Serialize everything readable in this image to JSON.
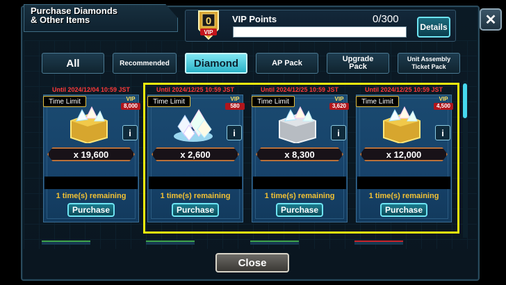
{
  "header": {
    "title_line1": "Purchase Diamonds",
    "title_line2": "& Other Items",
    "close_icon": "close-icon"
  },
  "vip": {
    "badge_level": "0",
    "badge_text": "VIP",
    "label": "VIP Points",
    "count": "0/300",
    "progress": 0,
    "details_label": "Details"
  },
  "tabs": [
    {
      "label": "All"
    },
    {
      "label": "Recommended"
    },
    {
      "label": "Diamond",
      "active": true
    },
    {
      "label": "AP Pack"
    },
    {
      "label": "Upgrade Pack"
    },
    {
      "label": "Unit Assembly Ticket Pack"
    }
  ],
  "cards": [
    {
      "until": "Until 2024/12/04 10:59 JST",
      "time_limit": "Time Limit",
      "vip_label": "VIP",
      "vip_value": "8,000",
      "quantity": "x 19,600",
      "remaining": "1 time(s) remaining",
      "purchase": "Purchase",
      "info": "i",
      "icon": "gold-crate-diamonds-icon"
    },
    {
      "until": "Until 2024/12/25 10:59 JST",
      "time_limit": "Time Limit",
      "vip_label": "VIP",
      "vip_value": "580",
      "quantity": "x 2,600",
      "remaining": "1 time(s) remaining",
      "purchase": "Purchase",
      "info": "i",
      "icon": "diamond-pile-icon"
    },
    {
      "until": "Until 2024/12/25 10:59 JST",
      "time_limit": "Time Limit",
      "vip_label": "VIP",
      "vip_value": "3,620",
      "quantity": "x 8,300",
      "remaining": "1 time(s) remaining",
      "purchase": "Purchase",
      "info": "i",
      "icon": "silver-crate-diamonds-icon"
    },
    {
      "until": "Until 2024/12/25 10:59 JST",
      "time_limit": "Time Limit",
      "vip_label": "VIP",
      "vip_value": "4,500",
      "quantity": "x 12,000",
      "remaining": "1 time(s) remaining",
      "purchase": "Purchase",
      "info": "i",
      "icon": "gold-crate-diamonds-icon"
    }
  ],
  "footer": {
    "close_label": "Close"
  },
  "colors": {
    "accent": "#46d9ee",
    "highlight": "#f1ec0e",
    "remaining": "#f3c234",
    "until": "#ff3a3a"
  }
}
